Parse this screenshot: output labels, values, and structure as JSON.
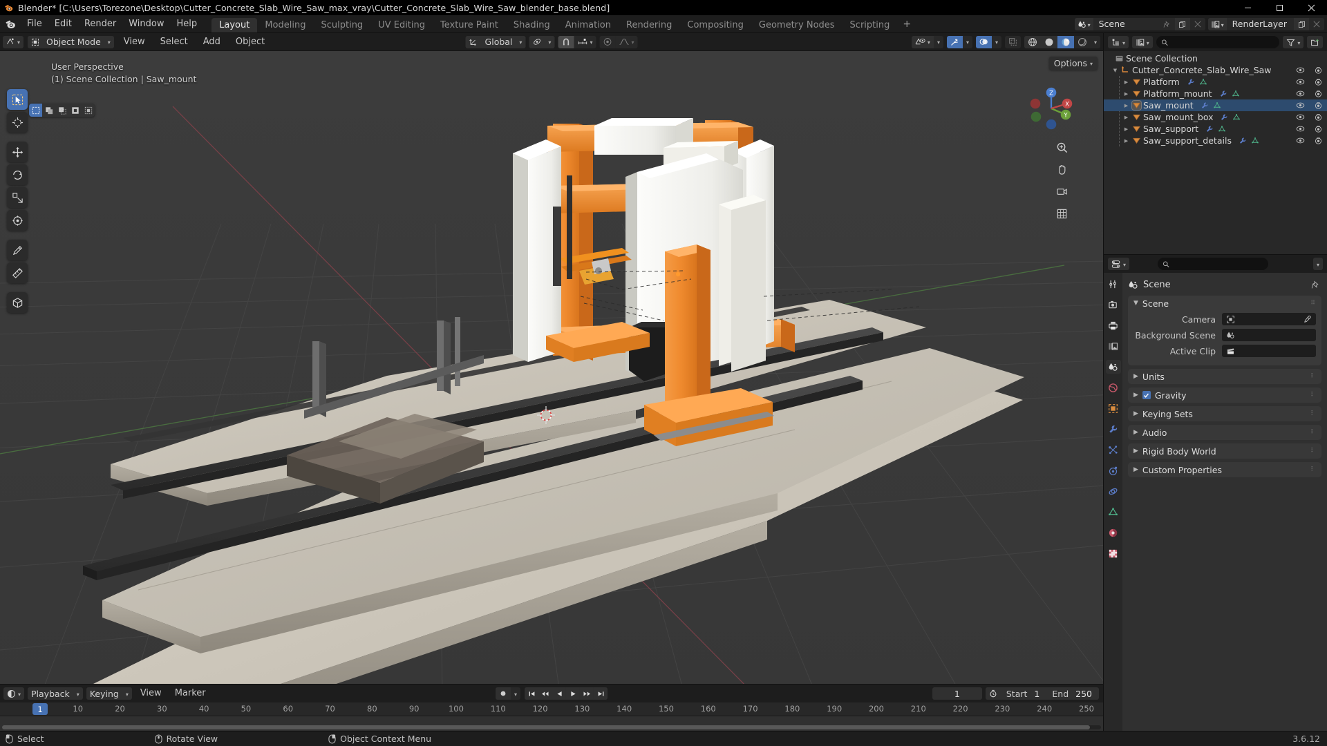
{
  "window": {
    "title": "Blender* [C:\\Users\\Torezone\\Desktop\\Cutter_Concrete_Slab_Wire_Saw_max_vray\\Cutter_Concrete_Slab_Wire_Saw_blender_base.blend]",
    "minimize": "–",
    "maximize": "❐",
    "close": "✕"
  },
  "topbar": {
    "menus": [
      "File",
      "Edit",
      "Render",
      "Window",
      "Help"
    ],
    "workspaces": [
      "Layout",
      "Modeling",
      "Sculpting",
      "UV Editing",
      "Texture Paint",
      "Shading",
      "Animation",
      "Rendering",
      "Compositing",
      "Geometry Nodes",
      "Scripting"
    ],
    "add_workspace": "+",
    "active_workspace": "Layout",
    "scene_name": "Scene",
    "viewlayer_name": "RenderLayer"
  },
  "viewport": {
    "mode": "Object Mode",
    "menus": [
      "View",
      "Select",
      "Add",
      "Object"
    ],
    "transform_orientation": "Global",
    "overlay_line1": "User Perspective",
    "overlay_line2": "(1) Scene Collection | Saw_mount",
    "options_label": "Options",
    "gizmo_axes": {
      "z": "Z",
      "y": "Y",
      "x": "X"
    },
    "tools": [
      "tweak-tool",
      "cursor-tool",
      "move-tool",
      "rotate-tool",
      "scale-tool",
      "transform-tool",
      "annotate-tool",
      "measure-tool",
      "add-cube-tool"
    ],
    "select_modes": [
      "select-box",
      "select-extend",
      "select-subtract",
      "select-invert",
      "select-intersect"
    ],
    "shading_modes": [
      "wireframe",
      "solid",
      "material-preview",
      "rendered"
    ],
    "active_shading": "material-preview"
  },
  "outliner": {
    "display_mode": "View Layer",
    "search_placeholder": "",
    "root": "Scene Collection",
    "collection": "Cutter_Concrete_Slab_Wire_Saw",
    "objects": [
      {
        "name": "Platform",
        "selected": false,
        "active": false
      },
      {
        "name": "Platform_mount",
        "selected": false,
        "active": false
      },
      {
        "name": "Saw_mount",
        "selected": true,
        "active": true
      },
      {
        "name": "Saw_mount_box",
        "selected": false,
        "active": false
      },
      {
        "name": "Saw_support",
        "selected": false,
        "active": false
      },
      {
        "name": "Saw_support_details",
        "selected": false,
        "active": false
      }
    ]
  },
  "properties": {
    "search_placeholder": "",
    "breadcrumb": "Scene",
    "tabs": [
      "tool-tab",
      "render-tab",
      "output-tab",
      "viewlayer-tab",
      "scene-tab",
      "world-tab",
      "object-tab",
      "modifier-tab",
      "particles-tab",
      "physics-tab",
      "constraints-tab",
      "data-tab",
      "material-tab",
      "texture-tab"
    ],
    "active_tab": "scene-tab",
    "scene_panel": {
      "title": "Scene",
      "rows": [
        {
          "label": "Camera",
          "value": "",
          "icon": "camera-icon"
        },
        {
          "label": "Background Scene",
          "value": "",
          "icon": "scene-icon"
        },
        {
          "label": "Active Clip",
          "value": "",
          "icon": "clip-icon"
        }
      ]
    },
    "panels": [
      {
        "title": "Units",
        "checkbox": null
      },
      {
        "title": "Gravity",
        "checkbox": true
      },
      {
        "title": "Keying Sets",
        "checkbox": null
      },
      {
        "title": "Audio",
        "checkbox": null
      },
      {
        "title": "Rigid Body World",
        "checkbox": null
      },
      {
        "title": "Custom Properties",
        "checkbox": null
      }
    ]
  },
  "timeline": {
    "menus": [
      "Playback",
      "Keying",
      "View",
      "Marker"
    ],
    "current_frame": "1",
    "start_label": "Start",
    "start_value": "1",
    "end_label": "End",
    "end_value": "250",
    "ticks": [
      "10",
      "20",
      "30",
      "40",
      "50",
      "60",
      "70",
      "80",
      "90",
      "100",
      "110",
      "120",
      "130",
      "140",
      "150",
      "160",
      "170",
      "180",
      "190",
      "200",
      "210",
      "220",
      "230",
      "240",
      "250"
    ],
    "playhead_frame": "1"
  },
  "statusbar": {
    "items": [
      {
        "icon": "mouse-left-icon",
        "label": "Select"
      },
      {
        "icon": "mouse-middle-icon",
        "label": "Rotate View"
      },
      {
        "icon": "mouse-right-icon",
        "label": "Object Context Menu"
      }
    ],
    "version": "3.6.12"
  },
  "colors": {
    "accent_blue": "#4772b3",
    "orange": "#ec8734",
    "header_bg": "#1d1d1d",
    "panel_bg": "#303030",
    "viewport_bg": "#393939"
  }
}
